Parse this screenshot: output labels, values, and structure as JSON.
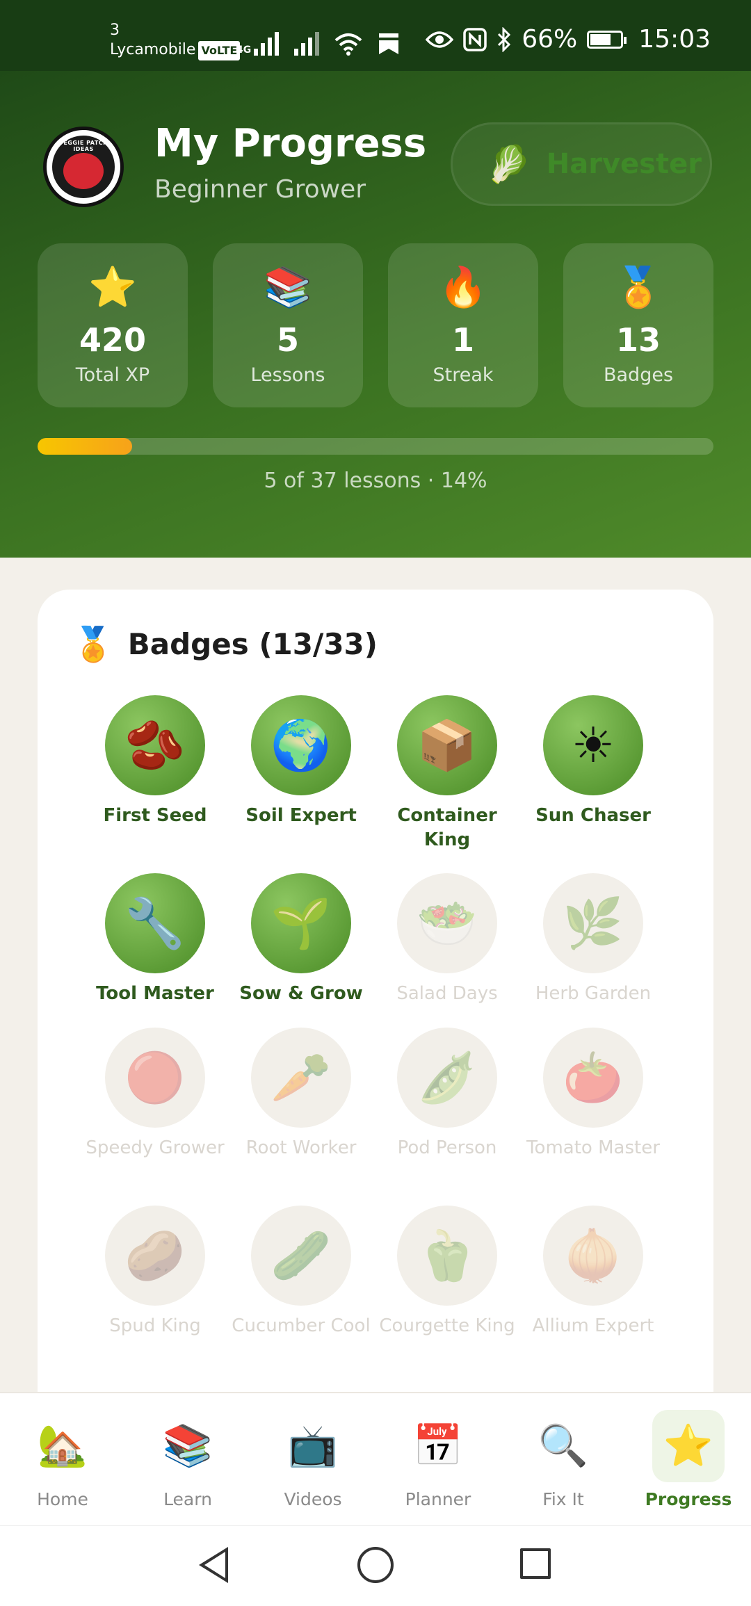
{
  "status_bar": {
    "carrier_line1": "3",
    "carrier_line2": "Lycamobile",
    "volte": "VoLTE",
    "network": "4G",
    "battery": "66%",
    "time": "15:03"
  },
  "header": {
    "logo_text": "VEGGIE PATCH IDEAS",
    "title": "My Progress",
    "subtitle": "Beginner Grower",
    "level_icon": "lettuce-icon",
    "level_label": "Harvester"
  },
  "stats": [
    {
      "icon": "⭐",
      "icon_name": "star-icon",
      "value": "420",
      "label": "Total XP"
    },
    {
      "icon": "📚",
      "icon_name": "books-icon",
      "value": "5",
      "label": "Lessons"
    },
    {
      "icon": "🔥",
      "icon_name": "fire-icon",
      "value": "1",
      "label": "Streak"
    },
    {
      "icon": "🏅",
      "icon_name": "medal-icon",
      "value": "13",
      "label": "Badges"
    }
  ],
  "progress": {
    "fraction": 0.14,
    "text": "5 of 37 lessons · 14%"
  },
  "badges_section": {
    "icon": "🏅",
    "title": "Badges (13/33)",
    "badges": [
      {
        "icon": "🫘",
        "name": "First Seed",
        "earned": true
      },
      {
        "icon": "🌍",
        "name": "Soil Expert",
        "earned": true
      },
      {
        "icon": "📦",
        "name": "Container King",
        "earned": true
      },
      {
        "icon": "☀",
        "name": "Sun Chaser",
        "earned": true
      },
      {
        "icon": "🔧",
        "name": "Tool Master",
        "earned": true
      },
      {
        "icon": "🌱",
        "name": "Sow & Grow",
        "earned": true
      },
      {
        "icon": "🥗",
        "name": "Salad Days",
        "earned": false
      },
      {
        "icon": "🌿",
        "name": "Herb Garden",
        "earned": false
      },
      {
        "icon": "🔴",
        "name": "Speedy Grower",
        "earned": false
      },
      {
        "icon": "🥕",
        "name": "Root Worker",
        "earned": false
      },
      {
        "icon": "🫛",
        "name": "Pod Person",
        "earned": false
      },
      {
        "icon": "🍅",
        "name": "Tomato Master",
        "earned": false
      },
      {
        "icon": "🥔",
        "name": "Spud King",
        "earned": false
      },
      {
        "icon": "🥒",
        "name": "Cucumber Cool",
        "earned": false
      },
      {
        "icon": "🫑",
        "name": "Courgette King",
        "earned": false
      },
      {
        "icon": "🧅",
        "name": "Allium Expert",
        "earned": false
      }
    ]
  },
  "bottom_nav": [
    {
      "icon": "🏡",
      "icon_name": "home-icon",
      "label": "Home",
      "active": false
    },
    {
      "icon": "📚",
      "icon_name": "books-icon",
      "label": "Learn",
      "active": false
    },
    {
      "icon": "📺",
      "icon_name": "tv-icon",
      "label": "Videos",
      "active": false
    },
    {
      "icon": "📅",
      "icon_name": "calendar-icon",
      "label": "Planner",
      "active": false
    },
    {
      "icon": "🔍",
      "icon_name": "magnifier-icon",
      "label": "Fix It",
      "active": false
    },
    {
      "icon": "⭐",
      "icon_name": "star-icon",
      "label": "Progress",
      "active": true
    }
  ],
  "colors": {
    "header_dark": "#1f4a17",
    "header_light": "#4f8a2a",
    "accent_green": "#3e7a22",
    "progress_yellow": "#f7c600"
  }
}
